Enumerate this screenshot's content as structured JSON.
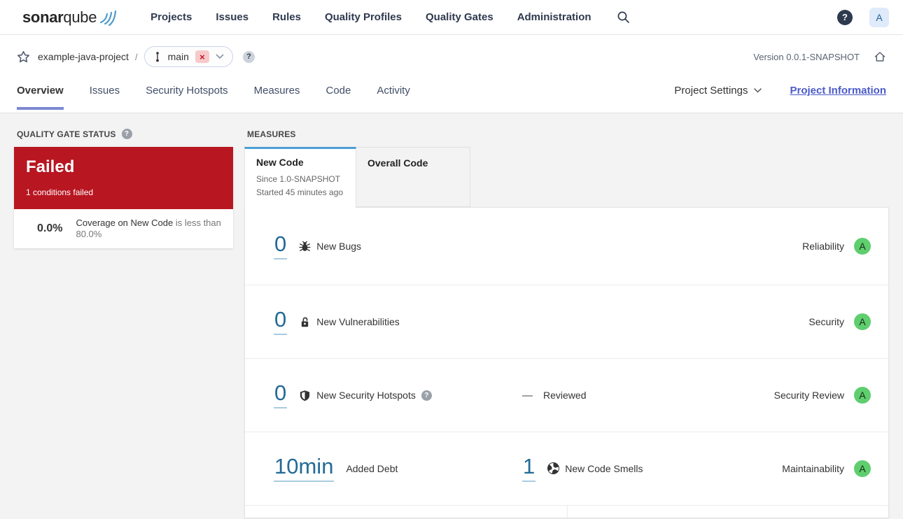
{
  "colors": {
    "failed_red": "#b81621",
    "rating_green_a": "#5fce6e",
    "link_blue": "#236a97",
    "active_code_tab_blue": "#4b9fd5",
    "overview_underline_purple": "#7c88d2",
    "project_info_link": "#4a5ac8",
    "logo_wave_blue": "#4e9bcd",
    "branch_badge_red": "#c5161f"
  },
  "header": {
    "logo_bold": "sonar",
    "logo_light": "qube",
    "nav": [
      "Projects",
      "Issues",
      "Rules",
      "Quality Profiles",
      "Quality Gates",
      "Administration"
    ],
    "help_label": "?",
    "avatar_label": "A"
  },
  "breadcrumb": {
    "project": "example-java-project",
    "separator": "/",
    "branch": "main",
    "branch_remove": "×",
    "branch_help": "?",
    "version": "Version 0.0.1-SNAPSHOT"
  },
  "tabs": {
    "items": [
      "Overview",
      "Issues",
      "Security Hotspots",
      "Measures",
      "Code",
      "Activity"
    ],
    "active": "Overview",
    "project_settings": "Project Settings",
    "project_information": "Project Information"
  },
  "quality_gate": {
    "title": "QUALITY GATE STATUS",
    "help": "?",
    "status": "Failed",
    "conditions_summary": "1 conditions failed",
    "condition": {
      "value": "0.0%",
      "metric": "Coverage on New Code",
      "comparison": "is less than 80.0%"
    }
  },
  "measures": {
    "title": "MEASURES",
    "code_tabs": [
      {
        "label": "New Code",
        "sub1": "Since 1.0-SNAPSHOT",
        "sub2": "Started 45 minutes ago"
      },
      {
        "label": "Overall Code"
      }
    ],
    "rows": [
      {
        "value": "0",
        "label": "New Bugs",
        "icon": "bug-icon",
        "rating_label": "Reliability",
        "rating": "A"
      },
      {
        "value": "0",
        "label": "New Vulnerabilities",
        "icon": "unlock-icon",
        "rating_label": "Security",
        "rating": "A"
      },
      {
        "value": "0",
        "label": "New Security Hotspots",
        "icon": "shield-icon",
        "help": "?",
        "reviewed_dash": "—",
        "reviewed_label": "Reviewed",
        "rating_label": "Security Review",
        "rating": "A"
      },
      {
        "value": "10min",
        "label": "Added Debt",
        "second_value": "1",
        "second_label": "New Code Smells",
        "second_icon": "code-smell-icon",
        "rating_label": "Maintainability",
        "rating": "A"
      }
    ]
  }
}
